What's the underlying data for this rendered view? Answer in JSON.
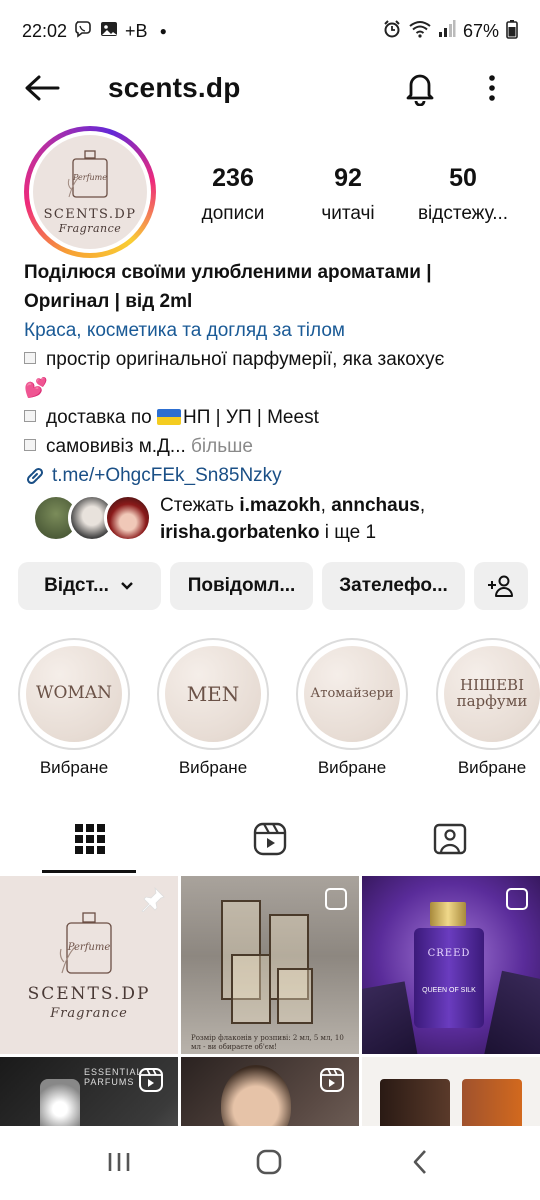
{
  "status_bar": {
    "time": "22:02",
    "notif_extra": "+B",
    "battery": "67%"
  },
  "header": {
    "username": "scents.dp"
  },
  "avatar": {
    "logo_small": "Perfume",
    "logo_line1": "SCENTS.DP",
    "logo_line2": "Fragrance"
  },
  "stats": [
    {
      "value": "236",
      "label": "дописи"
    },
    {
      "value": "92",
      "label": "читачі"
    },
    {
      "value": "50",
      "label": "відстежу..."
    }
  ],
  "bio": {
    "name_line1": "Поділюся своїми улюбленими ароматами |",
    "name_line2": "Оригінал | від 2ml",
    "category": "Краса, косметика та догляд за тілом",
    "line1": "простір оригінальної парфумерії, яка закохує",
    "line1_emoji": "💕",
    "line2_text": "НП | УП | Meest",
    "line2_prefix": "доставка по ",
    "line3": "самовивіз м.Д...",
    "line3_more": " більше",
    "link": "t.me/+OhgcFEk_Sn85Nzky"
  },
  "followed_by": {
    "prefix": "Стежать ",
    "name1": "i.mazokh",
    "name2": "annchaus",
    "name3": "irisha.gorbatenko",
    "suffix": " і ще 1"
  },
  "actions": {
    "follow": "Відст...",
    "message": "Повідомл...",
    "call": "Зателефо..."
  },
  "highlights": [
    {
      "cover": "WOMAN",
      "label": "Вибране"
    },
    {
      "cover": "MEN",
      "label": "Вибране"
    },
    {
      "cover": "Атомайзери",
      "label": "Вибране"
    },
    {
      "cover": "НІШЕВІ парфуми",
      "label": "Вибране"
    }
  ],
  "grid": {
    "post1_line1": "SCENTS.DP",
    "post1_line2": "Fragrance",
    "post1_small": "Perfume",
    "post2_caption": "Розмір флаконів у розпиві: 2 мл, 5 мл, 10 мл - ви обираєте об'єм!",
    "post3_line1": "CREED",
    "post3_line2": "QUEEN OF SILK",
    "post4_text": "ESSENTIAL PARFUMS"
  },
  "colors": {
    "link": "#1a4f86",
    "category": "#1a5a96",
    "button_bg": "#efefef"
  }
}
